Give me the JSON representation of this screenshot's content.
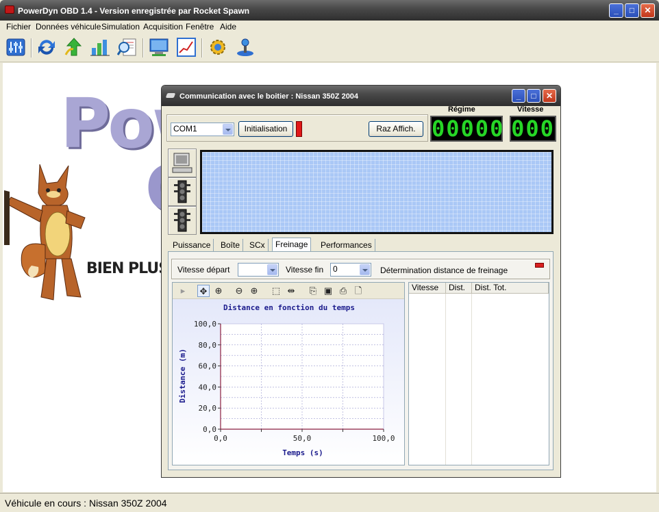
{
  "app": {
    "title": "PowerDyn OBD 1.4 - Version enregistrée par Rocket Spawn",
    "menu": [
      "Fichier",
      "Données véhicule",
      "Simulation",
      "Acquisition",
      "Fenêtre",
      "Aide"
    ],
    "toolbar_icons": [
      "settings-sliders-icon",
      "refresh-icon",
      "up-arrow-icon",
      "bar-chart-icon",
      "search-report-icon",
      "monitor-icon",
      "line-chart-icon",
      "gear-icon",
      "joystick-icon"
    ],
    "status": "Véhicule en cours : Nissan 350Z 2004"
  },
  "logo": {
    "letters": "Pow",
    "letters2": "O",
    "slogan": "BIEN PLUS"
  },
  "comm": {
    "title": "Communication avec le boitier : Nissan 350Z 2004",
    "port": "COM1",
    "init_label": "Initialisation",
    "raz_label": "Raz Affich.",
    "regime_label": "Régime",
    "regime_value": "00000",
    "vitesse_label": "Vitesse",
    "vitesse_value": "000",
    "tabs": [
      "Puissance",
      "Boîte",
      "SCx",
      "Freinage",
      "Performances"
    ],
    "active_tab": "Freinage",
    "freinage": {
      "vitesse_depart_label": "Vitesse départ",
      "vitesse_depart_value": "",
      "vitesse_fin_label": "Vitesse fin",
      "vitesse_fin_value": "0",
      "determination_label": "Détermination distance de freinage",
      "table_headers": [
        "Vitesse",
        "Dist.",
        "Dist. Tot."
      ]
    }
  },
  "colors": {
    "titlebar": "#3f3f3f",
    "lcd": "#aac8f6",
    "led_digits": "#26d626",
    "axis_text": "#1a1a8c"
  },
  "chart_data": {
    "type": "line",
    "title": "Distance en fonction du temps",
    "xlabel": "Temps (s)",
    "ylabel": "Distance (m)",
    "xlim": [
      0,
      100
    ],
    "ylim": [
      0,
      100
    ],
    "x_ticks": [
      "0,0",
      "50,0",
      "100,0"
    ],
    "y_ticks": [
      "0,0",
      "20,0",
      "40,0",
      "60,0",
      "80,0",
      "100,0"
    ],
    "series": [],
    "grid": true
  }
}
